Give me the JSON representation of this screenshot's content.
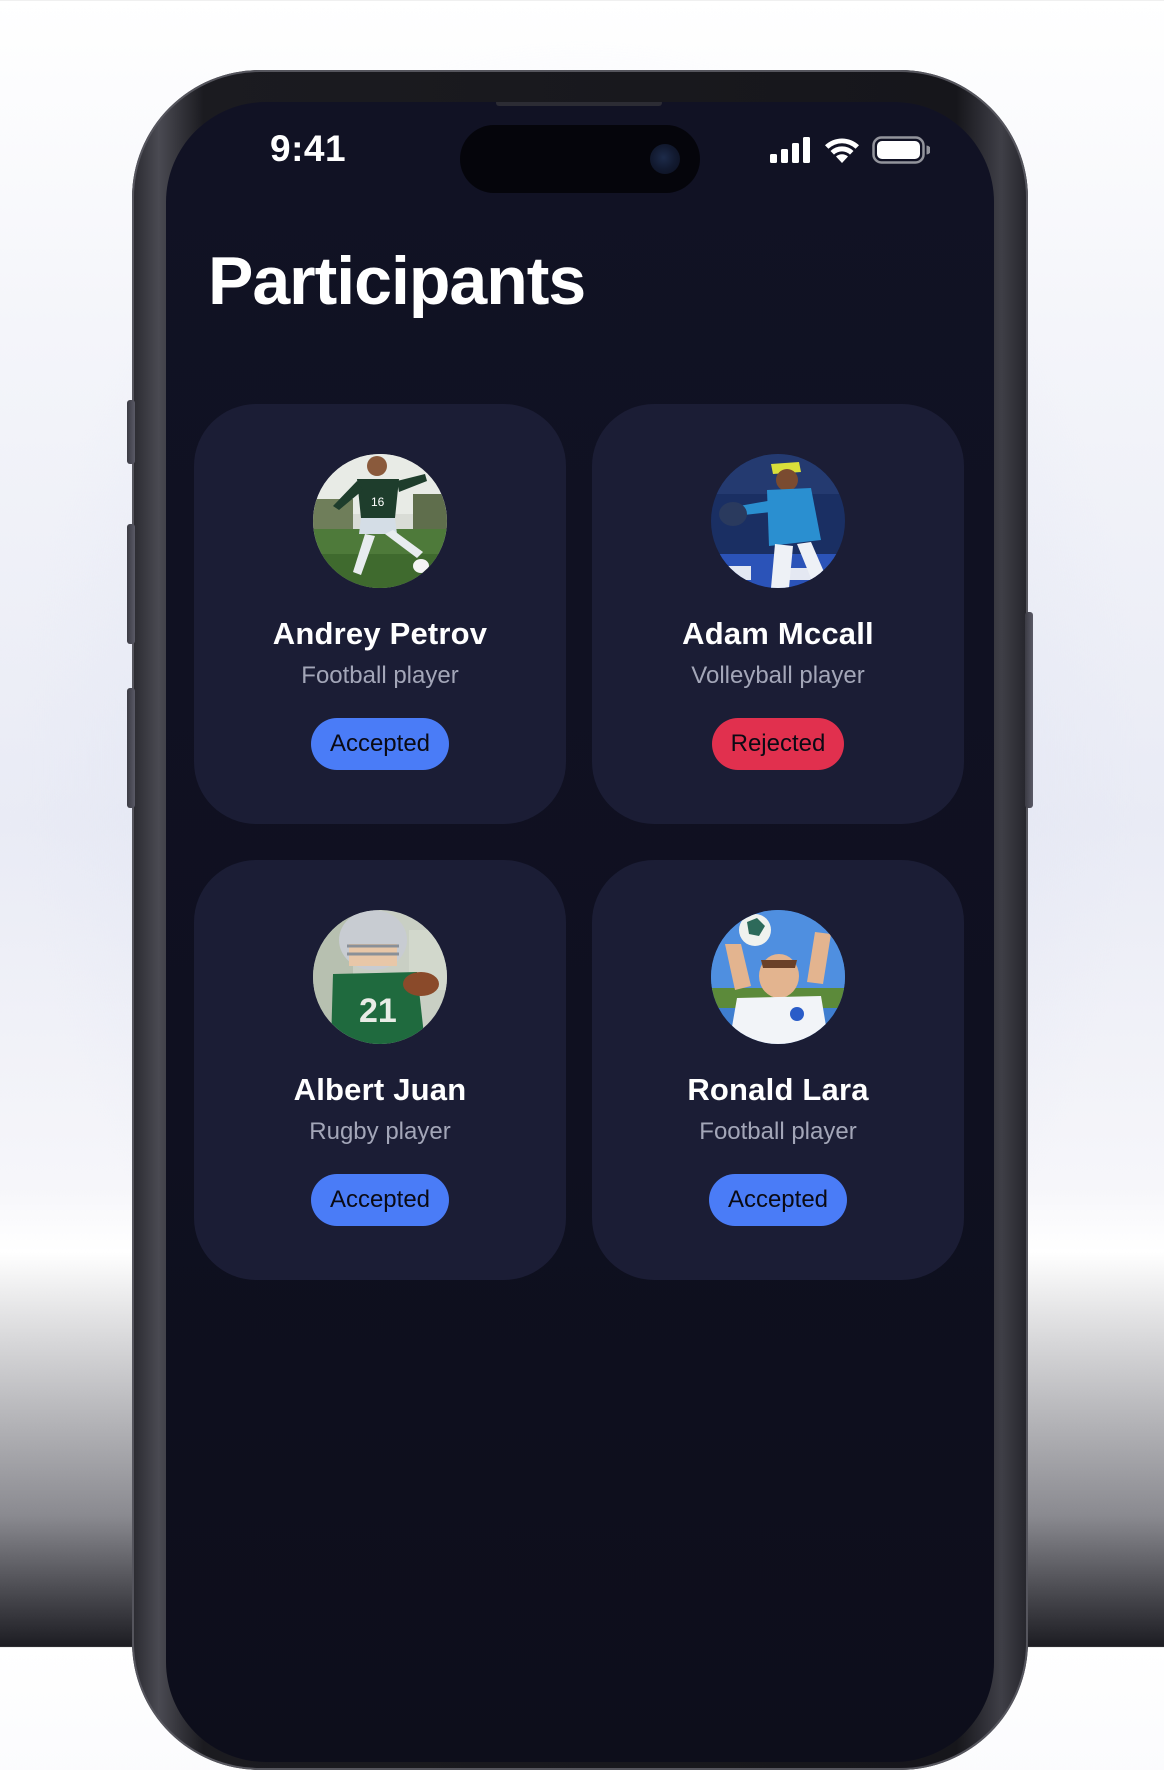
{
  "status_bar": {
    "time": "9:41",
    "signal_icon": "cellular-signal-icon",
    "wifi_icon": "wifi-icon",
    "battery_icon": "battery-icon"
  },
  "header": {
    "title": "Participants"
  },
  "participants": [
    {
      "name": "Andrey Petrov",
      "role": "Football player",
      "status": "Accepted",
      "status_color": "#4a7cf7",
      "avatar": "football-player-kicking-photo"
    },
    {
      "name": "Adam Mccall",
      "role": "Volleyball player",
      "status": "Rejected",
      "status_color": "#e1304e",
      "avatar": "pitcher-throwing-photo"
    },
    {
      "name": "Albert Juan",
      "role": "Rugby player",
      "status": "Accepted",
      "status_color": "#4a7cf7",
      "avatar": "helmeted-player-photo"
    },
    {
      "name": "Ronald Lara",
      "role": "Football player",
      "status": "Accepted",
      "status_color": "#4a7cf7",
      "avatar": "goalkeeper-ball-photo"
    }
  ]
}
